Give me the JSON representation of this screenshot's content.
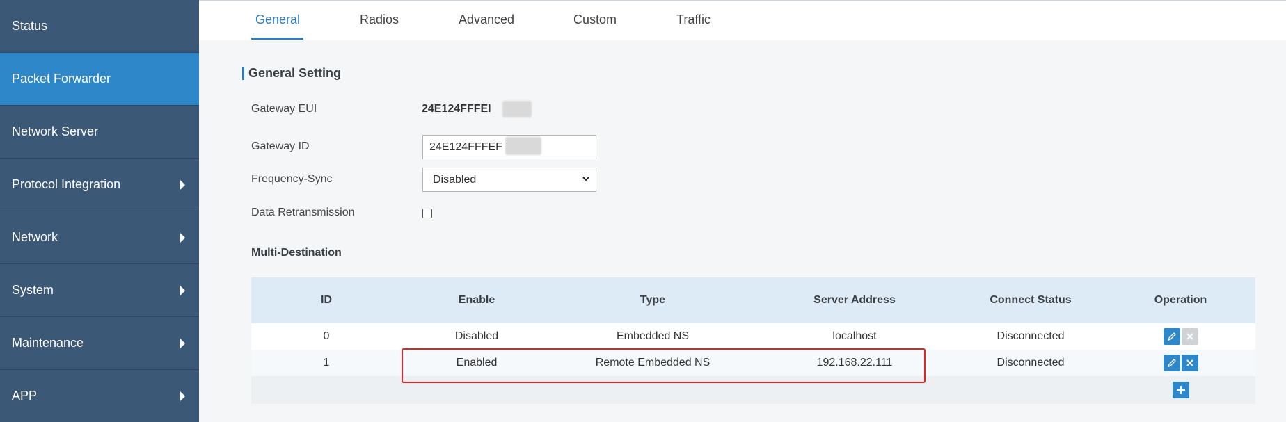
{
  "sidebar": {
    "items": [
      {
        "label": "Status",
        "has_submenu": false,
        "active": false
      },
      {
        "label": "Packet Forwarder",
        "has_submenu": false,
        "active": true
      },
      {
        "label": "Network Server",
        "has_submenu": false,
        "active": false
      },
      {
        "label": "Protocol Integration",
        "has_submenu": true,
        "active": false
      },
      {
        "label": "Network",
        "has_submenu": true,
        "active": false
      },
      {
        "label": "System",
        "has_submenu": true,
        "active": false
      },
      {
        "label": "Maintenance",
        "has_submenu": true,
        "active": false
      },
      {
        "label": "APP",
        "has_submenu": true,
        "active": false
      }
    ]
  },
  "tabs": [
    {
      "label": "General",
      "active": true
    },
    {
      "label": "Radios",
      "active": false
    },
    {
      "label": "Advanced",
      "active": false
    },
    {
      "label": "Custom",
      "active": false
    },
    {
      "label": "Traffic",
      "active": false
    }
  ],
  "general_setting": {
    "title": "General Setting",
    "gateway_eui_label": "Gateway EUI",
    "gateway_eui_value": "24E124FFFEI",
    "gateway_id_label": "Gateway ID",
    "gateway_id_value": "24E124FFFEF",
    "frequency_sync_label": "Frequency-Sync",
    "frequency_sync_value": "Disabled",
    "data_retransmission_label": "Data Retransmission",
    "data_retransmission_checked": false
  },
  "multi_destination": {
    "title": "Multi-Destination",
    "columns": [
      "ID",
      "Enable",
      "Type",
      "Server Address",
      "Connect Status",
      "Operation"
    ],
    "rows": [
      {
        "id": "0",
        "enable": "Disabled",
        "type": "Embedded NS",
        "server_address": "localhost",
        "connect_status": "Disconnected"
      },
      {
        "id": "1",
        "enable": "Enabled",
        "type": "Remote Embedded NS",
        "server_address": "192.168.22.111",
        "connect_status": "Disconnected"
      }
    ]
  },
  "colors": {
    "sidebar_bg": "#3c5877",
    "sidebar_active": "#2d87c8",
    "accent": "#2d7dc0",
    "highlight_box": "#e32424"
  }
}
